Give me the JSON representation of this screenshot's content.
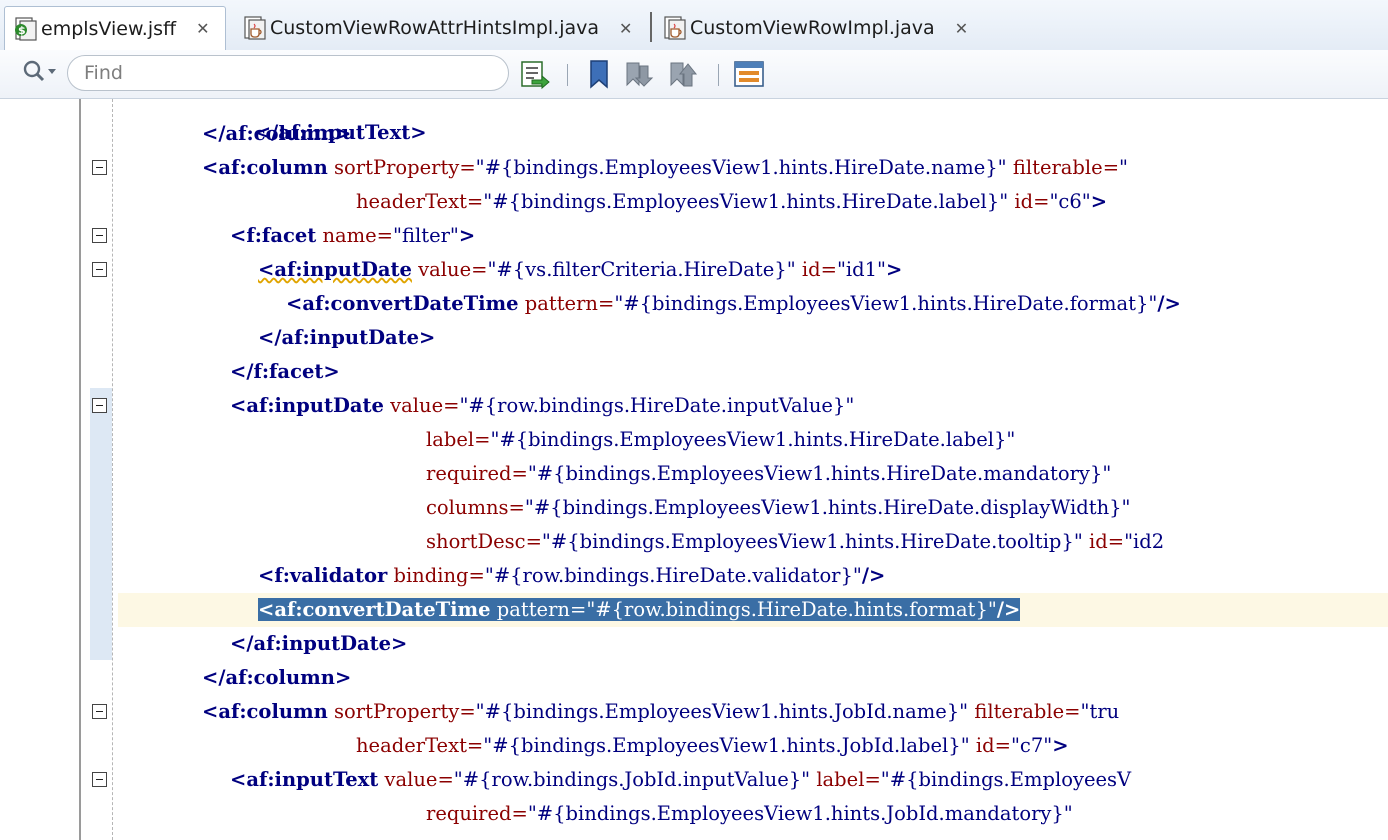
{
  "tabs": [
    {
      "label": "emplsView.jsff",
      "icon": "jsff-file-icon",
      "active": true
    },
    {
      "label": "CustomViewRowAttrHintsImpl.java",
      "icon": "java-file-icon",
      "active": false
    },
    {
      "label": "CustomViewRowImpl.java",
      "icon": "java-file-icon",
      "active": false
    }
  ],
  "toolbar": {
    "search_placeholder": "Find",
    "buttons": [
      "goto-line-icon",
      "toggle-bookmark-icon",
      "previous-bookmark-icon",
      "next-bookmark-icon",
      "show-structure-icon"
    ]
  },
  "code": {
    "partial_line": "</af:inputText>",
    "lines": [
      {
        "indent": "    ",
        "tag": "</af:column>",
        "a1": "",
        "v1": "",
        "a2": "",
        "v2": "",
        "close": "",
        "fold": false
      },
      {
        "indent": "    ",
        "tag": "<af:column",
        "a1": " sortProperty=",
        "v1": "\"#{bindings.EmployeesView1.hints.HireDate.name}\"",
        "a2": " filterable=",
        "v2": "\"",
        "close": "",
        "fold": true
      },
      {
        "indent": "               ",
        "tag": "",
        "a1": "headerText=",
        "v1": "\"#{bindings.EmployeesView1.hints.HireDate.label}\"",
        "a2": " id=",
        "v2": "\"c6\"",
        "close": ">",
        "fold": false
      },
      {
        "indent": "      ",
        "tag": "<f:facet",
        "a1": " name=",
        "v1": "\"filter\"",
        "a2": "",
        "v2": "",
        "close": ">",
        "fold": true
      },
      {
        "indent": "        ",
        "tag": "<af:inputDate",
        "a1": " value=",
        "v1": "\"#{vs.filterCriteria.HireDate}\"",
        "a2": " id=",
        "v2": "\"id1\"",
        "close": ">",
        "fold": true,
        "squiggle": true
      },
      {
        "indent": "          ",
        "tag": "<af:convertDateTime",
        "a1": " pattern=",
        "v1": "\"#{bindings.EmployeesView1.hints.HireDate.format}\"",
        "a2": "",
        "v2": "",
        "close": "/>",
        "fold": false
      },
      {
        "indent": "        ",
        "tag": "</af:inputDate>",
        "a1": "",
        "v1": "",
        "a2": "",
        "v2": "",
        "close": "",
        "fold": false
      },
      {
        "indent": "      ",
        "tag": "</f:facet>",
        "a1": "",
        "v1": "",
        "a2": "",
        "v2": "",
        "close": "",
        "fold": false
      },
      {
        "indent": "      ",
        "tag": "<af:inputDate",
        "a1": " value=",
        "v1": "\"#{row.bindings.HireDate.inputValue}\"",
        "a2": "",
        "v2": "",
        "close": "",
        "fold": true
      },
      {
        "indent": "                    ",
        "tag": "",
        "a1": "label=",
        "v1": "\"#{bindings.EmployeesView1.hints.HireDate.label}\"",
        "a2": "",
        "v2": "",
        "close": "",
        "fold": false
      },
      {
        "indent": "                    ",
        "tag": "",
        "a1": "required=",
        "v1": "\"#{bindings.EmployeesView1.hints.HireDate.mandatory}\"",
        "a2": "",
        "v2": "",
        "close": "",
        "fold": false
      },
      {
        "indent": "                    ",
        "tag": "",
        "a1": "columns=",
        "v1": "\"#{bindings.EmployeesView1.hints.HireDate.displayWidth}\"",
        "a2": "",
        "v2": "",
        "close": "",
        "fold": false
      },
      {
        "indent": "                    ",
        "tag": "",
        "a1": "shortDesc=",
        "v1": "\"#{bindings.EmployeesView1.hints.HireDate.tooltip}\"",
        "a2": " id=",
        "v2": "\"id2",
        "close": "",
        "fold": false
      },
      {
        "indent": "        ",
        "tag": "<f:validator",
        "a1": " binding=",
        "v1": "\"#{row.bindings.HireDate.validator}\"",
        "a2": "",
        "v2": "",
        "close": "/>",
        "fold": false
      },
      {
        "indent": "        ",
        "tag": "<af:convertDateTime",
        "a1": " pattern=",
        "v1": "\"#{row.bindings.HireDate.hints.format}\"",
        "a2": "",
        "v2": "",
        "close": "/>",
        "fold": false,
        "selected": true
      },
      {
        "indent": "      ",
        "tag": "</af:inputDate>",
        "a1": "",
        "v1": "",
        "a2": "",
        "v2": "",
        "close": "",
        "fold": false
      },
      {
        "indent": "    ",
        "tag": "</af:column>",
        "a1": "",
        "v1": "",
        "a2": "",
        "v2": "",
        "close": "",
        "fold": false
      },
      {
        "indent": "    ",
        "tag": "<af:column",
        "a1": " sortProperty=",
        "v1": "\"#{bindings.EmployeesView1.hints.JobId.name}\"",
        "a2": " filterable=",
        "v2": "\"tru",
        "close": "",
        "fold": true
      },
      {
        "indent": "               ",
        "tag": "",
        "a1": "headerText=",
        "v1": "\"#{bindings.EmployeesView1.hints.JobId.label}\"",
        "a2": " id=",
        "v2": "\"c7\"",
        "close": ">",
        "fold": false
      },
      {
        "indent": "      ",
        "tag": "<af:inputText",
        "a1": " value=",
        "v1": "\"#{row.bindings.JobId.inputValue}\"",
        "a2": " label=",
        "v2": "\"#{bindings.EmployeesV",
        "close": "",
        "fold": true
      },
      {
        "indent": "                    ",
        "tag": "",
        "a1": "required=",
        "v1": "\"#{bindings.EmployeesView1.hints.JobId.mandatory}\"",
        "a2": "",
        "v2": "",
        "close": "",
        "fold": false
      }
    ]
  }
}
